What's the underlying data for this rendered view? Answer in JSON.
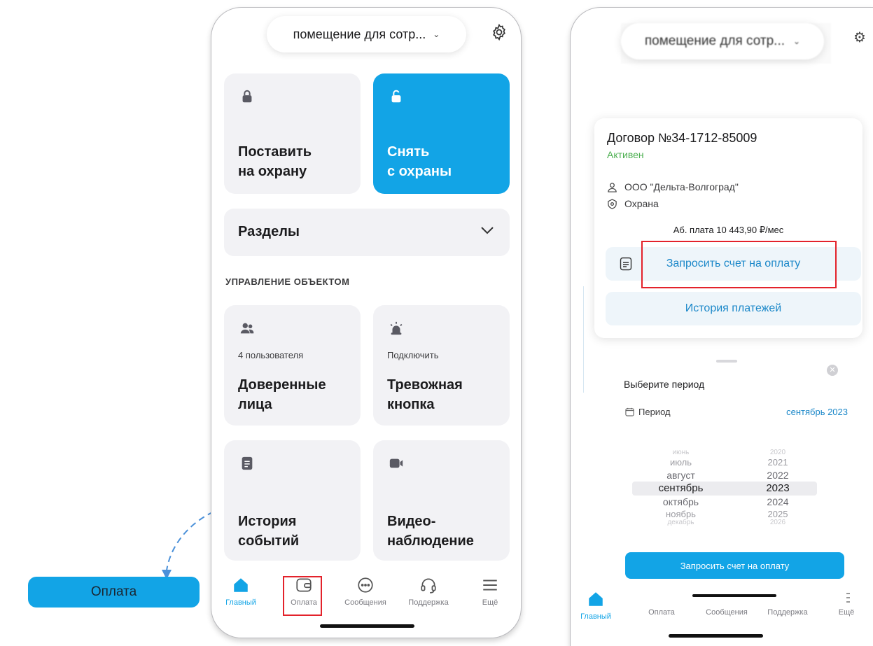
{
  "callout": {
    "label": "Оплата"
  },
  "left": {
    "object_selector": "помещение для сотр...",
    "tiles": {
      "arm": {
        "title_line1": "Поставить",
        "title_line2": "на охрану"
      },
      "disarm": {
        "title_line1": "Снять",
        "title_line2": "с охраны"
      },
      "trusted": {
        "sub": "4 пользователя",
        "title_line1": "Доверенные",
        "title_line2": "лица"
      },
      "alarm": {
        "sub": "Подключить",
        "title_line1": "Тревожная",
        "title_line2": "кнопка"
      },
      "history": {
        "title_line1": "История",
        "title_line2": "событий"
      },
      "video": {
        "title_line1": "Видео-",
        "title_line2": "наблюдение"
      }
    },
    "sections_label": "Разделы",
    "section_heading": "УПРАВЛЕНИЕ ОБЪЕКТОМ",
    "nav": [
      "Главный",
      "Оплата",
      "Сообщения",
      "Поддержка",
      "Ещё"
    ]
  },
  "right": {
    "object_selector": "помещение для сотр...",
    "contract": {
      "title": "Договор №34-1712-85009",
      "status": "Активен",
      "company": "ООО \"Дельта-Волгоград\"",
      "service": "Охрана",
      "fee": "Аб. плата 10 443,90 ₽/мес",
      "request_button": "Запросить счет на оплату",
      "history_button": "История платежей"
    },
    "sheet": {
      "title": "Выберите период",
      "period_label": "Период",
      "period_value": "сентябрь 2023",
      "months": [
        "июнь",
        "июль",
        "август",
        "сентябрь",
        "октябрь",
        "ноябрь",
        "декабрь"
      ],
      "years": [
        "2020",
        "2021",
        "2022",
        "2023",
        "2024",
        "2025",
        "2026"
      ],
      "request_button": "Запросить счет на оплату"
    },
    "nav": [
      "Главный",
      "Оплата",
      "Сообщения",
      "Поддержка",
      "Ещё"
    ]
  },
  "colors": {
    "accent": "#12a4e6",
    "highlight": "#e3222b",
    "status_active": "#4caf50"
  }
}
